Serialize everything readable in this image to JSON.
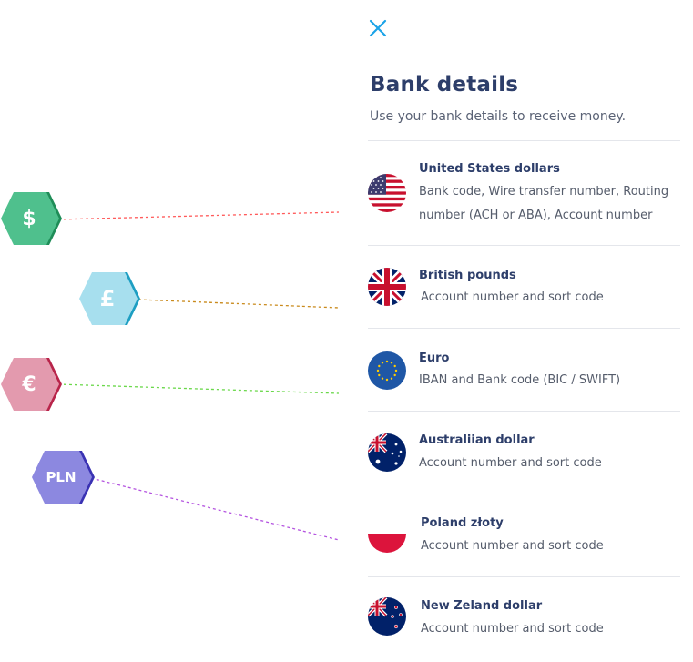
{
  "panel": {
    "title": "Bank details",
    "subtitle": "Use your bank details to receive money."
  },
  "currencies": [
    {
      "name": "United States dollars",
      "description": "Bank code, Wire transfer number, Routing number (ACH or ABA), Account number",
      "flag": "us-flag-icon"
    },
    {
      "name": "British pounds",
      "description": "Account number and sort code",
      "flag": "uk-flag-icon"
    },
    {
      "name": "Euro",
      "description": "IBAN and Bank code (BIC / SWIFT)",
      "flag": "eu-flag-icon"
    },
    {
      "name": "Australiian dollar",
      "description": "Account number and sort code",
      "flag": "au-flag-icon"
    },
    {
      "name": "Poland złoty",
      "description": "Account number and sort code",
      "flag": "pl-flag-icon"
    },
    {
      "name": "New Zeland dollar",
      "description": "Account number and sort code",
      "flag": "nz-flag-icon"
    }
  ],
  "badges": [
    {
      "symbol": "$",
      "color": "#4fc08d",
      "line_color": "#ff5a5a"
    },
    {
      "symbol": "£",
      "color": "#6ccbe0",
      "line_color": "#c98a1c"
    },
    {
      "symbol": "€",
      "color": "#d96b8a",
      "line_color": "#6ad84a"
    },
    {
      "symbol": "PLN",
      "color": "#6f6bd6",
      "line_color": "#b454e0"
    }
  ],
  "colors": {
    "accent": "#1aa3e8",
    "title": "#2d3e6a"
  },
  "icons": {
    "close": "close-icon"
  }
}
